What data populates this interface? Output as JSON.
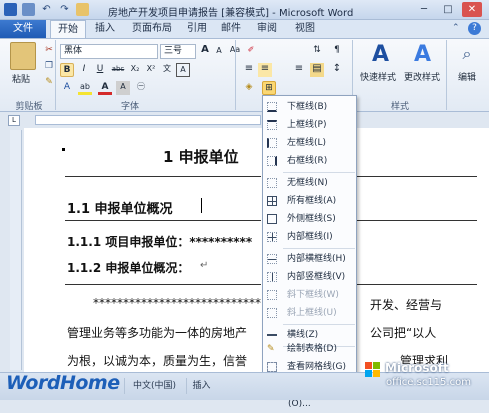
{
  "window": {
    "title": "房地产开发项目申请报告 [兼容模式] - Microsoft Word",
    "minimize": "─",
    "restore": "□",
    "close": "✕"
  },
  "tabs": [
    "文件",
    "开始",
    "插入",
    "页面布局",
    "引用",
    "邮件",
    "审阅",
    "视图"
  ],
  "ribbon": {
    "paste_label": "粘贴",
    "clipboard_label": "剪贴板",
    "font_name": "黑体",
    "font_size": "三号",
    "font_group_label": "字体",
    "styles_group_label": "样式",
    "quick_styles_label": "快速样式",
    "change_styles_label": "更改样式",
    "edit_label": "编辑",
    "bold": "B",
    "italic": "I",
    "underline": "U",
    "font_color": "A",
    "wen": "文",
    "aa_grow": "A",
    "aa_shrink": "A",
    "clear_fmt": "Aa",
    "wen_a": "wén",
    "a_box": "A",
    "abc": "abc",
    "x2": "X₂",
    "xsq": "X²",
    "ab": "ab"
  },
  "document": {
    "heading1": "1   申报单位",
    "heading2": "1.1   申报单位概况",
    "heading3a": "1.1.1 项目申报单位：**********",
    "heading3b": "1.1.2 申报单位概况：",
    "para1_left": "************************************",
    "para1_right": "开发、经营与",
    "para2_left": "管理业务等多功能为一体的房地产",
    "para2_right": "公司把“以人",
    "para3_left": "为根，以诚为本，质量为生，信誉",
    "para3_right": "管理求利",
    "return_mark": "↵"
  },
  "border_menu": {
    "items": [
      {
        "label": "下框线(B)",
        "icon": "bottom-border-icon",
        "disabled": false
      },
      {
        "label": "上框线(P)",
        "icon": "top-border-icon",
        "disabled": false
      },
      {
        "label": "左框线(L)",
        "icon": "left-border-icon",
        "disabled": false
      },
      {
        "label": "右框线(R)",
        "icon": "right-border-icon",
        "disabled": false
      },
      {
        "label": "无框线(N)",
        "icon": "no-border-icon",
        "disabled": false
      },
      {
        "label": "所有框线(A)",
        "icon": "all-borders-icon",
        "disabled": false
      },
      {
        "label": "外侧框线(S)",
        "icon": "outside-borders-icon",
        "disabled": false
      },
      {
        "label": "内部框线(I)",
        "icon": "inside-borders-icon",
        "disabled": false
      },
      {
        "label": "内部横框线(H)",
        "icon": "inside-horizontal-border-icon",
        "disabled": false
      },
      {
        "label": "内部竖框线(V)",
        "icon": "inside-vertical-border-icon",
        "disabled": false
      },
      {
        "label": "斜下框线(W)",
        "icon": "diagonal-down-border-icon",
        "disabled": true
      },
      {
        "label": "斜上框线(U)",
        "icon": "diagonal-up-border-icon",
        "disabled": true
      },
      {
        "label": "横线(Z)",
        "icon": "horizontal-line-icon",
        "disabled": false
      },
      {
        "label": "绘制表格(D)",
        "icon": "draw-table-icon",
        "disabled": false
      },
      {
        "label": "查看网格线(G)",
        "icon": "view-gridlines-icon",
        "disabled": false
      },
      {
        "label": "边框和底纹(O)...",
        "icon": "borders-shading-icon",
        "disabled": false
      }
    ]
  },
  "status": {
    "language": "中文(中国)",
    "mode": "插入"
  },
  "watermark": {
    "brand": "WordHome",
    "ms": "Microsoft",
    "site": "office.sc115.com"
  },
  "colors": {
    "accent": "#1f5bb5",
    "highlight": "#fbd772"
  }
}
